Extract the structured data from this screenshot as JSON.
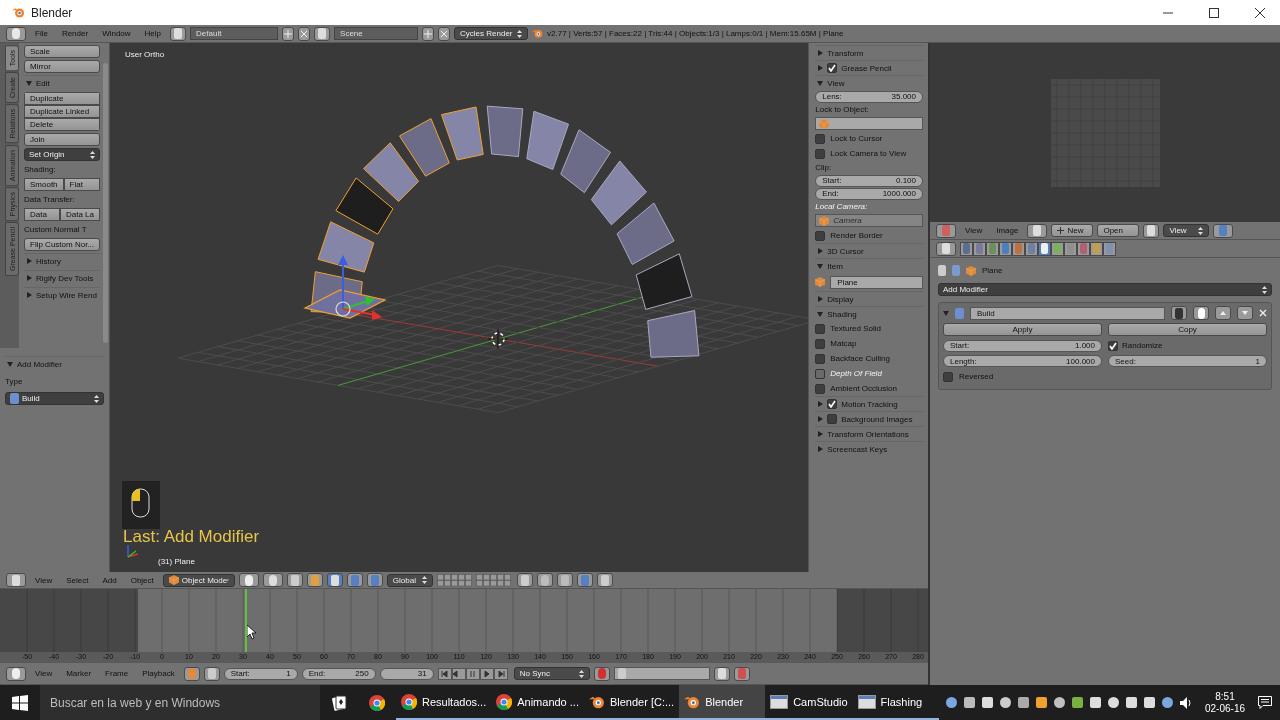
{
  "window": {
    "title": "Blender"
  },
  "info_header": {
    "menus": [
      "File",
      "Render",
      "Window",
      "Help"
    ],
    "screen_layout": "Default",
    "scene": "Scene",
    "render_engine": "Cycles Render",
    "stats": "v2.77 | Verts:57 | Faces:22 | Tris:44 | Objects:1/3 | Lamps:0/1 | Mem:15.65M | Plane"
  },
  "tool_shelf": {
    "tabs": [
      {
        "label": "Tools",
        "selected": true
      },
      {
        "label": "Create",
        "selected": false
      },
      {
        "label": "Relations",
        "selected": false
      },
      {
        "label": "Animation",
        "selected": false
      },
      {
        "label": "Physics",
        "selected": false
      },
      {
        "label": "Grease Pencil",
        "selected": false
      }
    ],
    "items": [
      {
        "kind": "button",
        "label": "Scale"
      },
      {
        "kind": "button",
        "label": "Mirror"
      },
      {
        "kind": "section",
        "label": "Edit",
        "expanded": true
      },
      {
        "kind": "group",
        "labels": [
          "Duplicate",
          "Duplicate Linked",
          "Delete"
        ]
      },
      {
        "kind": "button",
        "label": "Join"
      },
      {
        "kind": "dropdown",
        "label": "Set Origin"
      },
      {
        "kind": "label",
        "label": "Shading:"
      },
      {
        "kind": "pair",
        "labels": [
          "Smooth",
          "Flat"
        ]
      },
      {
        "kind": "label",
        "label": "Data Transfer:"
      },
      {
        "kind": "pair",
        "labels": [
          "Data",
          "Data La"
        ]
      },
      {
        "kind": "label",
        "label": "Custom Normal T"
      },
      {
        "kind": "button",
        "label": "Flip Custom Nor..."
      },
      {
        "kind": "section",
        "label": "History",
        "expanded": false
      },
      {
        "kind": "section",
        "label": "Rigify Dev Tools",
        "expanded": false
      },
      {
        "kind": "section",
        "label": "Setup Wire Rend",
        "expanded": false
      }
    ]
  },
  "last_operator": {
    "title": "Add Modifier",
    "expanded": true,
    "type_label": "Type",
    "type_value": "Build"
  },
  "viewport": {
    "view_name": "User Ortho",
    "last_operator_text": "Last: Add Modifier",
    "object_info": "(31) Plane"
  },
  "n_panel": {
    "items": [
      {
        "kind": "section",
        "label": "Transform",
        "expanded": false
      },
      {
        "kind": "section",
        "label": "Grease Pencil",
        "expanded": false,
        "checked": true
      },
      {
        "kind": "section",
        "label": "View",
        "expanded": true
      },
      {
        "kind": "number",
        "label": "Lens:",
        "value": "35.000"
      },
      {
        "kind": "label",
        "label": "Lock to Object:",
        "disabled": false
      },
      {
        "kind": "object_field",
        "disabled": false
      },
      {
        "kind": "checkbox",
        "label": "Lock to Cursor",
        "checked": false,
        "disabled": false
      },
      {
        "kind": "checkbox",
        "label": "Lock Camera to View",
        "checked": false,
        "disabled": false
      },
      {
        "kind": "label",
        "label": "Clip:",
        "disabled": false
      },
      {
        "kind": "number",
        "label": "Start:",
        "value": "0.100"
      },
      {
        "kind": "number",
        "label": "End:",
        "value": "1000.000"
      },
      {
        "kind": "label",
        "label": "Local Camera:",
        "disabled": true
      },
      {
        "kind": "object_field",
        "value": "Camera",
        "disabled": true
      },
      {
        "kind": "checkbox",
        "label": "Render Border",
        "checked": false,
        "disabled": false
      },
      {
        "kind": "section",
        "label": "3D Cursor",
        "expanded": false
      },
      {
        "kind": "section",
        "label": "Item",
        "expanded": true
      },
      {
        "kind": "object_name",
        "value": "Plane"
      },
      {
        "kind": "section",
        "label": "Display",
        "expanded": false
      },
      {
        "kind": "section",
        "label": "Shading",
        "expanded": true
      },
      {
        "kind": "checkbox",
        "label": "Textured Solid",
        "checked": false,
        "disabled": false
      },
      {
        "kind": "checkbox",
        "label": "Matcap",
        "checked": false,
        "disabled": false
      },
      {
        "kind": "checkbox",
        "label": "Backface Culling",
        "checked": false,
        "disabled": false
      },
      {
        "kind": "checkbox",
        "label": "Depth Of Field",
        "checked": false,
        "disabled": true
      },
      {
        "kind": "checkbox",
        "label": "Ambient Occlusion",
        "checked": false,
        "disabled": false
      },
      {
        "kind": "section",
        "label": "Motion Tracking",
        "expanded": false,
        "checked": true
      },
      {
        "kind": "section",
        "label": "Background Images",
        "expanded": false,
        "checked": false
      },
      {
        "kind": "section",
        "label": "Transform Orientations",
        "expanded": false
      },
      {
        "kind": "section",
        "label": "Screencast Keys",
        "expanded": false
      }
    ]
  },
  "view3d_header": {
    "menus": [
      "View",
      "Select",
      "Add",
      "Object"
    ],
    "mode": "Object Mode",
    "orientation": "Global"
  },
  "timeline": {
    "ticks": [
      "-50",
      "-40",
      "-30",
      "-20",
      "-10",
      "0",
      "10",
      "20",
      "30",
      "40",
      "50",
      "60",
      "70",
      "80",
      "90",
      "100",
      "110",
      "120",
      "130",
      "140",
      "150",
      "160",
      "170",
      "180",
      "190",
      "200",
      "210",
      "220",
      "230",
      "240",
      "250",
      "260",
      "270",
      "280"
    ]
  },
  "timeline_header": {
    "menus": [
      "View",
      "Marker",
      "Frame",
      "Playback"
    ],
    "start_label": "Start:",
    "start": "1",
    "end_label": "End:",
    "end": "250",
    "current": "31",
    "sync": "No Sync"
  },
  "image_editor": {
    "menus": [
      "View",
      "Image"
    ],
    "new": "New",
    "open": "Open",
    "view": "View"
  },
  "properties_editor": {
    "tabs": [
      {
        "selected": false
      },
      {
        "selected": false
      },
      {
        "selected": false
      },
      {
        "selected": false
      },
      {
        "selected": false
      },
      {
        "selected": false
      },
      {
        "selected": true
      },
      {
        "selected": false
      },
      {
        "selected": false
      },
      {
        "selected": false
      },
      {
        "selected": false
      },
      {
        "selected": false
      }
    ],
    "breadcrumb": "Plane",
    "add_modifier": "Add Modifier",
    "modifier": {
      "name": "Build",
      "expanded": true,
      "apply": "Apply",
      "copy": "Copy",
      "start_label": "Start:",
      "start": "1.000",
      "length_label": "Length:",
      "length": "100.000",
      "randomize": {
        "label": "Randomize",
        "checked": true
      },
      "seed_label": "Seed:",
      "seed": "1",
      "reversed": {
        "label": "Reversed",
        "checked": false
      }
    }
  },
  "taskbar": {
    "search_placeholder": "Buscar en la web y en Windows",
    "apps": [
      {
        "kind": "chrome",
        "label": "Resultados...",
        "selected": false
      },
      {
        "kind": "chrome",
        "label": "Animando ...",
        "selected": false
      },
      {
        "kind": "blender",
        "label": "Blender [C:...",
        "selected": false
      },
      {
        "kind": "blender",
        "label": "Blender",
        "selected": true
      },
      {
        "kind": "window",
        "label": "CamStudio",
        "selected": false
      },
      {
        "kind": "window",
        "label": "Flashing",
        "selected": false
      }
    ],
    "time": "8:51",
    "date": "02-06-16"
  }
}
